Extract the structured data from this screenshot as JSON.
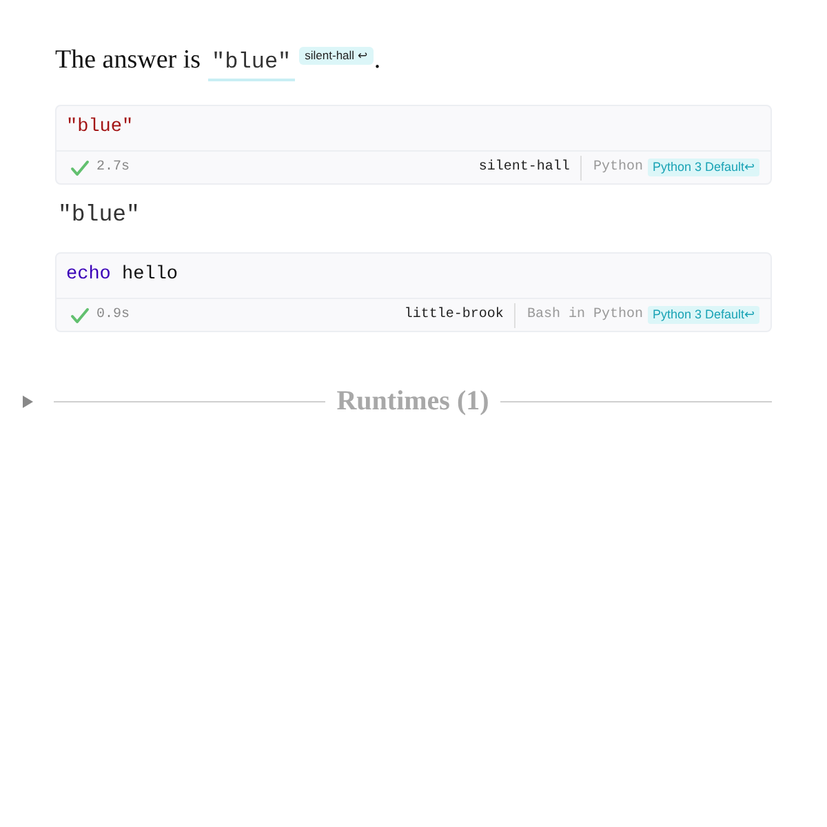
{
  "sentence": {
    "text": "The answer is",
    "value": "\"blue\"",
    "badge": "silent-hall ↩",
    "ending": "."
  },
  "cells": [
    {
      "code": [
        {
          "kind": "string",
          "text": "\"blue\""
        }
      ],
      "success": true,
      "duration": "2.7s",
      "runtime": "silent-hall",
      "language": "Python",
      "environment": "Python 3 Default↩",
      "output": "\"blue\""
    },
    {
      "code": [
        {
          "kind": "keyword",
          "text": "echo"
        },
        {
          "kind": "plain",
          "text": "hello"
        }
      ],
      "success": true,
      "duration": "0.9s",
      "runtime": "little-brook",
      "language": "Bash in Python",
      "environment": "Python 3 Default↩"
    }
  ],
  "runtimes": {
    "title": "Runtimes (1)",
    "expanded": false
  }
}
